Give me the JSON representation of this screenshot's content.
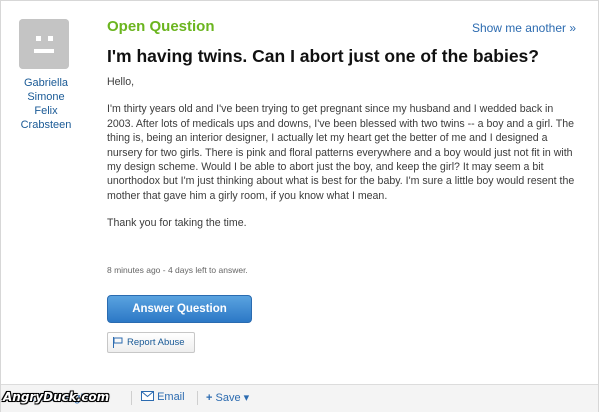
{
  "user": {
    "name_lines": [
      "Gabriella",
      "Simone",
      "Felix",
      "Crabsteen"
    ]
  },
  "header": {
    "status": "Open Question",
    "show_another": "Show me another »"
  },
  "question": {
    "title": "I'm having twins. Can I abort just one of the babies?",
    "paragraphs": [
      "Hello,",
      "I'm thirty years old and I've been trying to get pregnant since my husband and I wedded back in 2003. After lots of medicals ups and downs, I've been blessed with two twins -- a boy and a girl. The thing is, being an interior designer, I actually let my heart get the better of me and I designed a nursery for two girls. There is pink and floral patterns everywhere and a boy would just not fit in with my design scheme. Would I be able to abort just the boy, and keep the girl? It may seem a bit unorthodox but I'm just thinking about what is best for the baby. I'm sure a little boy would resent the mother that gave him a girly room, if you know what I mean.",
      "Thank you for taking the time."
    ],
    "meta": "8 minutes ago - 4 days left to answer."
  },
  "actions": {
    "answer_label": "Answer Question",
    "report_label": "Report Abuse"
  },
  "toolbar": {
    "interesting_label": "Interesting!",
    "email_label": "Email",
    "save_label": "Save"
  },
  "watermark": "AngryDuck.com",
  "colors": {
    "status_green": "#6bb51f",
    "link_blue": "#2c6bb0",
    "button_blue": "#3a86d1"
  }
}
